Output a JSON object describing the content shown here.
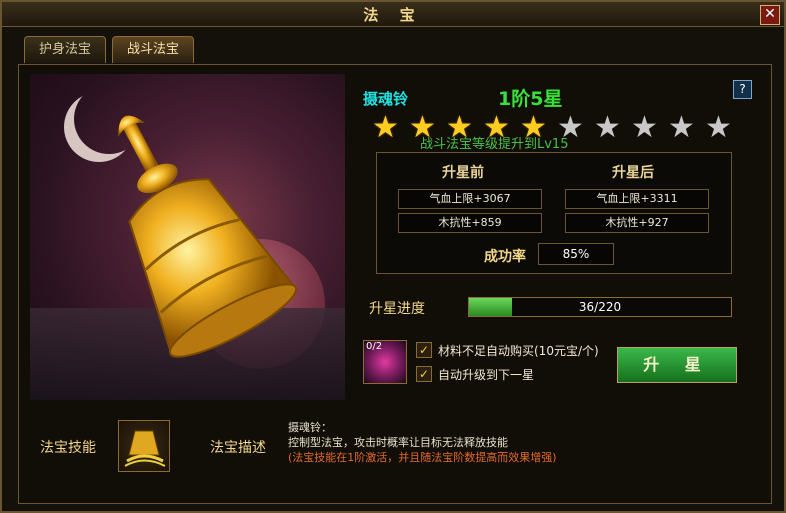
{
  "window": {
    "title": "法 宝",
    "close_label": "✕"
  },
  "tabs": [
    {
      "label": "护身法宝",
      "active": false
    },
    {
      "label": "战斗法宝",
      "active": true
    }
  ],
  "item": {
    "name": "摄魂铃",
    "grade": "1阶5星",
    "help_label": "?",
    "stars": {
      "filled": 5,
      "total": 10
    },
    "star_note": "战斗法宝等级提升到Lv15"
  },
  "compare": {
    "before_header": "升星前",
    "after_header": "升星后",
    "before": [
      "气血上限+3067",
      "木抗性+859"
    ],
    "after": [
      "气血上限+3311",
      "木抗性+927"
    ],
    "success_label": "成功率",
    "success_value": "85%"
  },
  "progress": {
    "label": "升星进度",
    "current": 36,
    "total": 220,
    "text": "36/220"
  },
  "material": {
    "count": "0/2"
  },
  "options": [
    {
      "label": "材料不足自动购买(10元宝/个)",
      "checked": true
    },
    {
      "label": "自动升级到下一星",
      "checked": true
    }
  ],
  "upgrade_button": "升 星",
  "skill": {
    "label": "法宝技能"
  },
  "description": {
    "label": "法宝描述",
    "title": "摄魂铃：",
    "text": "控制型法宝，攻击时概率让目标无法释放技能",
    "note": "(法宝技能在1阶激活，并且随法宝阶数提高而效果增强)"
  },
  "colors": {
    "accent_gold": "#f2d68a",
    "name_cyan": "#20e0e0",
    "grade_green": "#3ae03a",
    "note_orange": "#e46a2a"
  },
  "icons": {
    "close": "close-icon",
    "help": "help-icon",
    "bell": "bell-icon",
    "skill": "sound-wave-skill-icon",
    "material": "crystal-icon"
  }
}
